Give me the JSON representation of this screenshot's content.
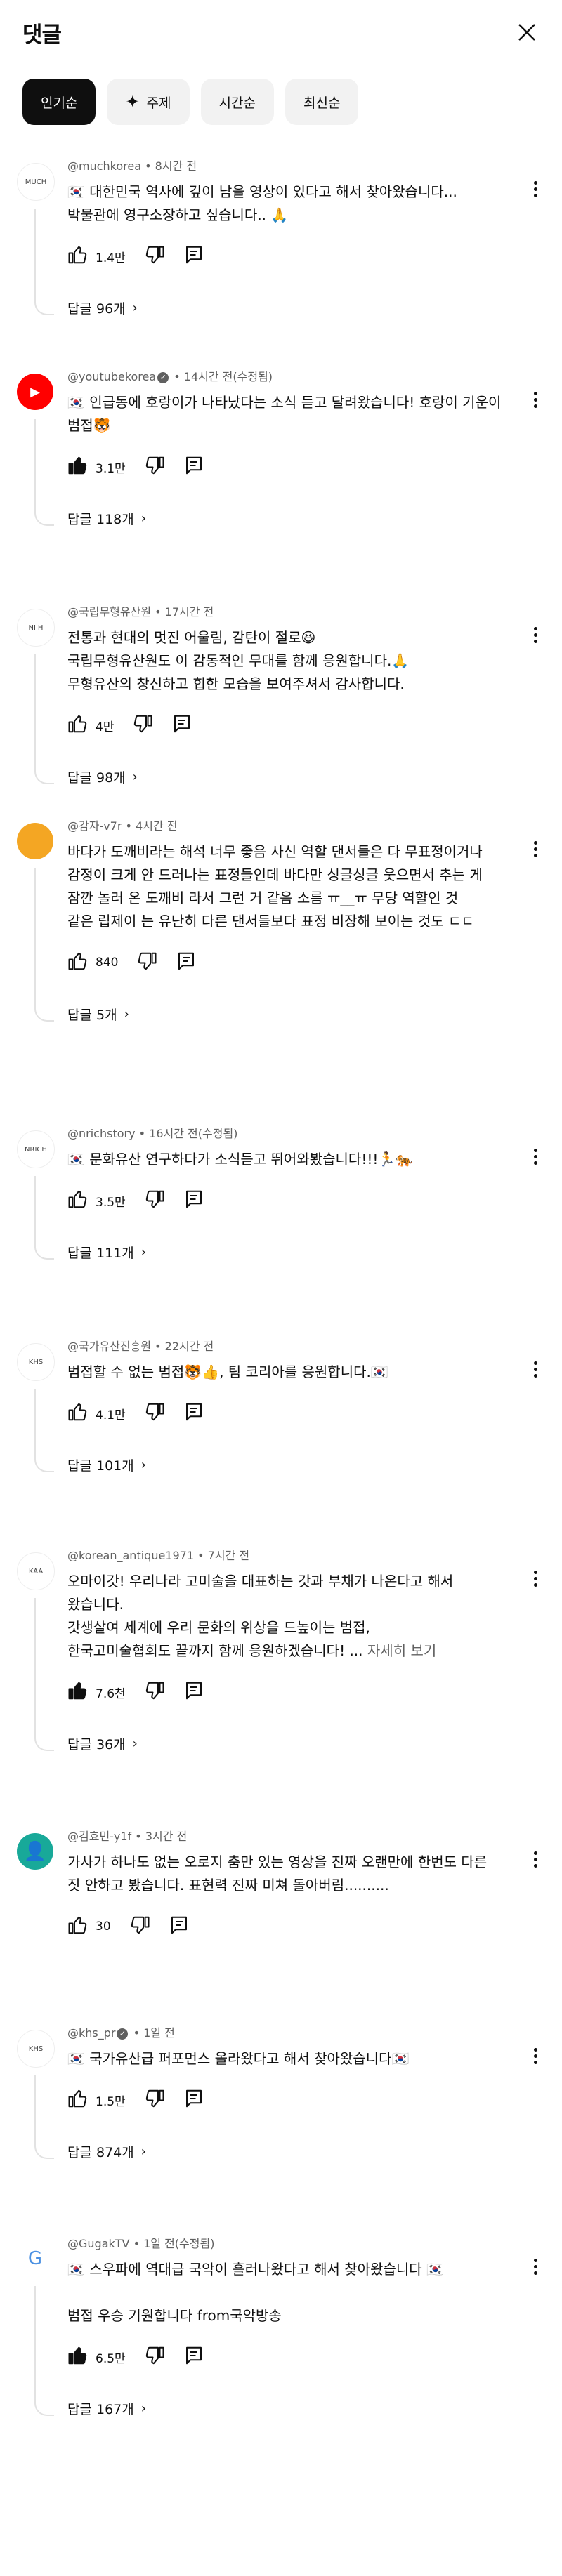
{
  "header": {
    "title": "댓글"
  },
  "chips": [
    {
      "label": "인기순",
      "active": true
    },
    {
      "label": "주제",
      "icon": "sparkle-icon"
    },
    {
      "label": "시간순"
    },
    {
      "label": "최신순"
    }
  ],
  "comments": [
    {
      "handle": "@muchkorea",
      "time": "8시간 전",
      "verified": false,
      "lines": [
        "🇰🇷 대한민국 역사에 깊이 남을 영상이 있다고 해서 찾아왔습니다...",
        "박물관에 영구소장하고 싶습니다.. 🙏"
      ],
      "likes": "1.4만",
      "liked": false,
      "replies": "답글 96개",
      "avatar_color": "#ffffff",
      "avatar_text": "MUCH"
    },
    {
      "handle": "@youtubekorea",
      "time": "14시간 전(수정됨)",
      "verified": true,
      "lines": [
        "🇰🇷 인급동에 호랑이가 나타났다는 소식 듣고 달려왔습니다! 호랑이 기운이",
        "범접🐯"
      ],
      "likes": "3.1만",
      "liked": true,
      "replies": "답글 118개",
      "avatar_color": "#ff0000",
      "avatar_text": "▶"
    },
    {
      "handle": "@국립무형유산원",
      "time": "17시간 전",
      "verified": false,
      "lines": [
        "전통과 현대의 멋진 어울림, 감탄이 절로😆",
        "국립무형유산원도 이 감동적인 무대를 함께 응원합니다.🙏",
        "무형유산의 창신하고 힙한 모습을 보여주셔서 감사합니다."
      ],
      "likes": "4만",
      "liked": false,
      "replies": "답글 98개",
      "avatar_color": "#ffffff",
      "avatar_text": "NIIH"
    },
    {
      "handle": "@감자-v7r",
      "time": "4시간 전",
      "verified": false,
      "lines": [
        "바다가 도깨비라는 해석 너무 좋음 사신 역할 댄서들은 다 무표정이거나",
        "감정이 크게 안 드러나는 표정들인데 바다만 싱글싱글 웃으면서 추는 게",
        "잠깐 놀러 온 도깨비 라서 그런 거 같음 소름 ㅠ__ㅠ 무당 역할인 것",
        "같은 립제이 는 유난히 다른 댄서들보다 표정 비장해 보이는 것도 ㄷㄷ"
      ],
      "likes": "840",
      "liked": false,
      "replies": "답글 5개",
      "avatar_color": "#f4a623",
      "avatar_text": ""
    },
    {
      "handle": "@nrichstory",
      "time": "16시간 전(수정됨)",
      "verified": false,
      "lines": [
        "🇰🇷 문화유산 연구하다가 소식듣고 뛰어와봤습니다!!!🏃🐅"
      ],
      "likes": "3.5만",
      "liked": false,
      "replies": "답글 111개",
      "avatar_color": "#ffffff",
      "avatar_text": "NRICH"
    },
    {
      "handle": "@국가유산진흥원",
      "time": "22시간 전",
      "verified": false,
      "lines": [
        "범접할 수 없는 범접🐯👍, 팀 코리아를 응원합니다.🇰🇷"
      ],
      "likes": "4.1만",
      "liked": false,
      "replies": "답글 101개",
      "avatar_color": "#ffffff",
      "avatar_text": "KHS"
    },
    {
      "handle": "@korean_antique1971",
      "time": "7시간 전",
      "verified": false,
      "lines": [
        "오마이갓! 우리나라 고미술을 대표하는 갓과 부채가 나온다고 해서",
        "왔습니다.",
        "갓생살여 세계에 우리 문화의 위상을 드높이는 범접,",
        "한국고미술협회도 끝까지 함께 응원하겠습니다! ..."
      ],
      "more": "자세히 보기",
      "likes": "7.6천",
      "liked": true,
      "replies": "답글 36개",
      "avatar_color": "#ffffff",
      "avatar_text": "KAA"
    },
    {
      "handle": "@김효민-y1f",
      "time": "3시간 전",
      "verified": false,
      "lines": [
        "가사가 하나도 없는 오로지 춤만 있는 영상을 진짜 오랜만에 한번도 다른",
        "짓 안하고 봤습니다. 표현력 진짜 미쳐 돌아버림.........."
      ],
      "likes": "30",
      "liked": false,
      "replies": "",
      "avatar_color": "#18a999",
      "avatar_text": "👤"
    },
    {
      "handle": "@khs_pr",
      "time": "1일 전",
      "verified": true,
      "lines": [
        "🇰🇷 국가유산급 퍼포먼스 올라왔다고 해서 찾아왔습니다🇰🇷"
      ],
      "likes": "1.5만",
      "liked": false,
      "replies": "답글 874개",
      "avatar_color": "#ffffff",
      "avatar_text": "KHS"
    },
    {
      "handle": "@GugakTV",
      "time": "1일 전(수정됨)",
      "verified": false,
      "lines": [
        "🇰🇷 스우파에 역대급 국악이 흘러나왔다고 해서 찾아왔습니다 🇰🇷",
        "",
        "범접 우승 기원합니다 from국악방송"
      ],
      "likes": "6.5만",
      "liked": true,
      "replies": "답글 167개",
      "avatar_color": "#ffffff",
      "avatar_text": "G"
    }
  ]
}
